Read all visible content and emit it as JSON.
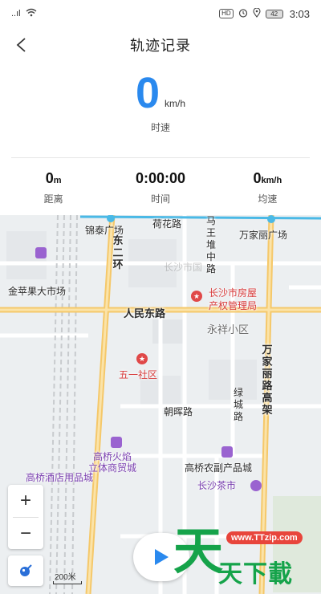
{
  "status_bar": {
    "signal_text": "..ıl",
    "hd_badge": "HD",
    "battery": "42",
    "time": "3:03"
  },
  "header": {
    "title": "轨迹记录"
  },
  "speed": {
    "value": "0",
    "unit": "km/h",
    "label": "时速"
  },
  "stats": [
    {
      "value": "0",
      "unit": "m",
      "label": "距离"
    },
    {
      "value": "0:00:00",
      "unit": "",
      "label": "时间"
    },
    {
      "value": "0",
      "unit": "km/h",
      "label": "均速"
    }
  ],
  "map": {
    "labels": {
      "hehua_road": "荷花路",
      "jintai_square": "锦泰广场",
      "east_2nd_ring": "东二环",
      "mawangdui_road": "马王堆中路",
      "wanjiali_square": "万家丽广场",
      "jinpingguo_market": "金苹果大市场",
      "changsha_real_estate": "长沙市房屋",
      "changsha_real_estate_2": "产权管理局",
      "renmin_east_road": "人民东路",
      "yongxiang_district": "永祥小区",
      "wanjiali_elevated": "万家丽路高架",
      "wuyi_community": "五一社区",
      "lucheng_road": "绿城路",
      "chaohui_road": "朝晖路",
      "gaoqiao_huoyan": "高桥火焰",
      "gaoqiao_huoyan_2": "立体商贸城",
      "gaoqiao_hotel_supplies": "高桥酒店用品城",
      "gaoqiao_agri": "高桥农副产品城",
      "changsha_tea_market": "长沙茶市",
      "faded_label": "长沙市国"
    },
    "zoom_in": "+",
    "zoom_out": "−",
    "scale_text": "200米"
  },
  "watermark": {
    "url": "www.TTzip.com",
    "big_char": "天",
    "text": "天下載"
  }
}
